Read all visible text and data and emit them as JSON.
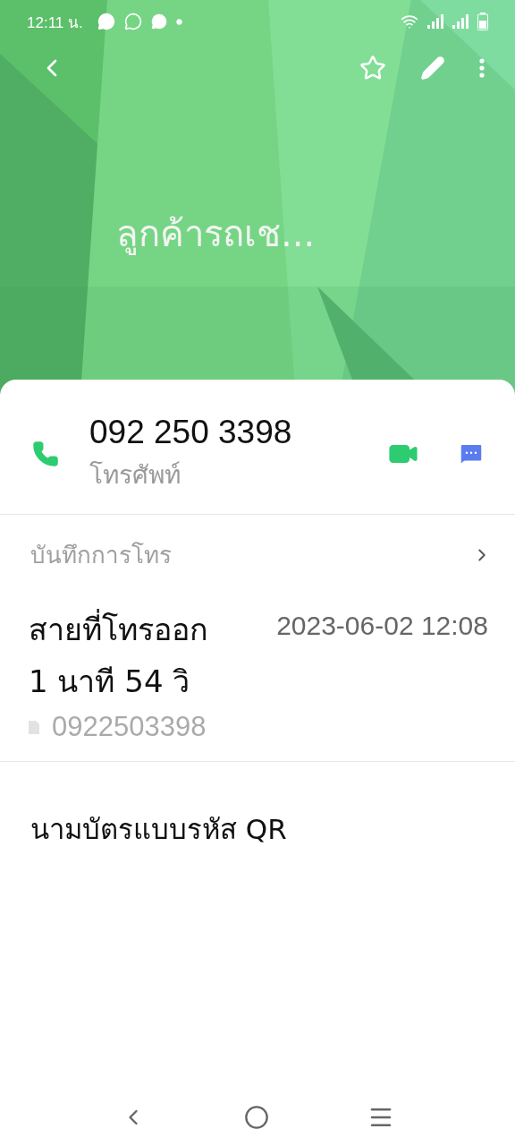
{
  "status_bar": {
    "time": "12:11 น."
  },
  "header": {
    "title": "ลูกค้ารถเช..."
  },
  "phone": {
    "number": "092 250 3398",
    "label": "โทรศัพท์"
  },
  "call_log": {
    "heading": "บันทึกการโทร",
    "entries": [
      {
        "type": "สายที่โทรออก",
        "duration": "1 นาที 54 วิ",
        "datetime": "2023-06-02 12:08",
        "sim_number": "0922503398"
      }
    ]
  },
  "qr_card": {
    "label": "นามบัตรแบบรหัส QR"
  }
}
